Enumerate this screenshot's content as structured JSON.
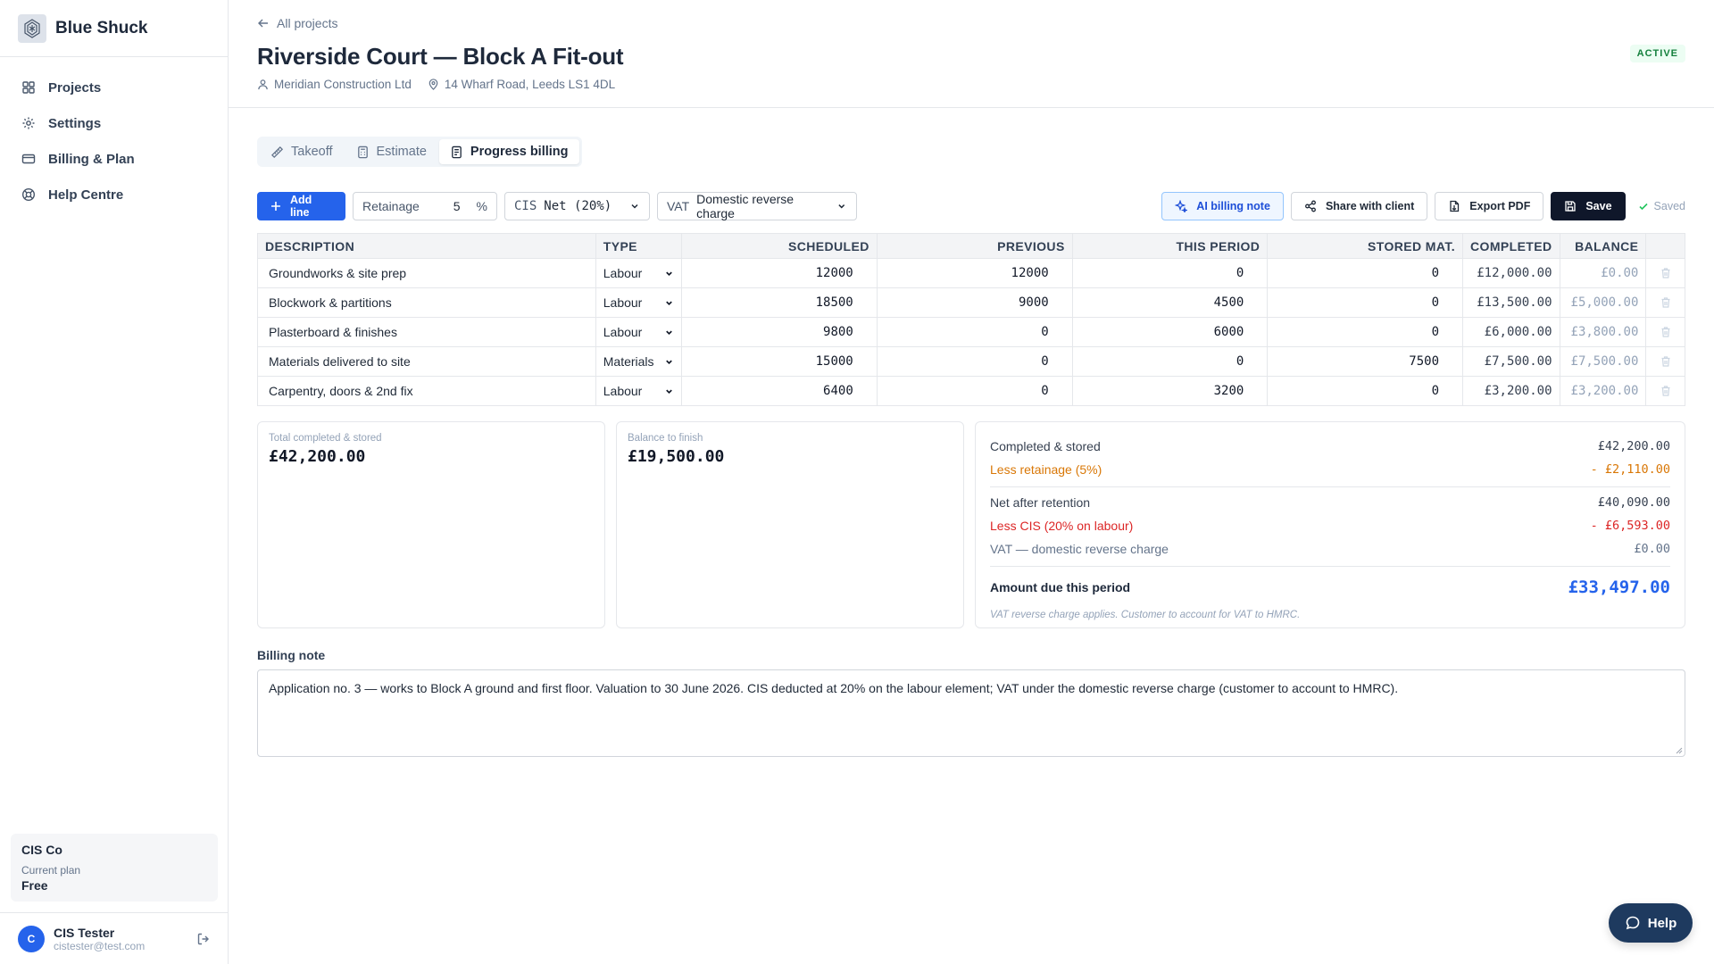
{
  "brand": {
    "name": "Blue Shuck"
  },
  "sidebar": {
    "items": [
      {
        "label": "Projects",
        "icon": "grid-icon"
      },
      {
        "label": "Settings",
        "icon": "gear-icon"
      },
      {
        "label": "Billing & Plan",
        "icon": "card-icon"
      },
      {
        "label": "Help Centre",
        "icon": "lifebuoy-icon"
      }
    ],
    "plan": {
      "company": "CIS Co",
      "label": "Current plan",
      "value": "Free"
    },
    "user": {
      "initial": "C",
      "name": "CIS Tester",
      "email": "cistester@test.com"
    }
  },
  "header": {
    "back_label": "All projects",
    "title": "Riverside Court — Block A Fit-out",
    "client": "Meridian Construction Ltd",
    "address": "14 Wharf Road, Leeds LS1 4DL",
    "status": "ACTIVE"
  },
  "tabs": [
    {
      "label": "Takeoff"
    },
    {
      "label": "Estimate"
    },
    {
      "label": "Progress billing",
      "active": true
    }
  ],
  "toolbar": {
    "add_line": "Add line",
    "retainage_label": "Retainage",
    "retainage_value": "5",
    "retainage_unit": "%",
    "cis_label": "CIS",
    "cis_value": "Net (20%)",
    "vat_label": "VAT",
    "vat_value": "Domestic reverse charge",
    "ai_note": "AI billing note",
    "share": "Share with client",
    "export": "Export PDF",
    "save": "Save",
    "saved": "Saved"
  },
  "table": {
    "columns": [
      "DESCRIPTION",
      "TYPE",
      "SCHEDULED",
      "PREVIOUS",
      "THIS PERIOD",
      "STORED MAT.",
      "COMPLETED",
      "BALANCE"
    ],
    "rows": [
      {
        "description": "Groundworks & site prep",
        "type": "Labour",
        "scheduled": "12000",
        "previous": "12000",
        "this_period": "0",
        "stored": "0",
        "completed": "£12,000.00",
        "balance": "£0.00"
      },
      {
        "description": "Blockwork & partitions",
        "type": "Labour",
        "scheduled": "18500",
        "previous": "9000",
        "this_period": "4500",
        "stored": "0",
        "completed": "£13,500.00",
        "balance": "£5,000.00"
      },
      {
        "description": "Plasterboard & finishes",
        "type": "Labour",
        "scheduled": "9800",
        "previous": "0",
        "this_period": "6000",
        "stored": "0",
        "completed": "£6,000.00",
        "balance": "£3,800.00"
      },
      {
        "description": "Materials delivered to site",
        "type": "Materials",
        "scheduled": "15000",
        "previous": "0",
        "this_period": "0",
        "stored": "7500",
        "completed": "£7,500.00",
        "balance": "£7,500.00"
      },
      {
        "description": "Carpentry, doors & 2nd fix",
        "type": "Labour",
        "scheduled": "6400",
        "previous": "0",
        "this_period": "3200",
        "stored": "0",
        "completed": "£3,200.00",
        "balance": "£3,200.00"
      }
    ]
  },
  "summary": {
    "total_label": "Total completed & stored",
    "total_value": "£42,200.00",
    "balance_label": "Balance to finish",
    "balance_value": "£19,500.00",
    "breakdown": {
      "completed_label": "Completed & stored",
      "completed_value": "£42,200.00",
      "retainage_label": "Less retainage (5%)",
      "retainage_value": "- £2,110.00",
      "net_label": "Net after retention",
      "net_value": "£40,090.00",
      "cis_label": "Less CIS (20% on labour)",
      "cis_value": "- £6,593.00",
      "vat_label": "VAT — domestic reverse charge",
      "vat_value": "£0.00",
      "due_label": "Amount due this period",
      "due_value": "£33,497.00",
      "footnote": "VAT reverse charge applies. Customer to account for VAT to HMRC."
    }
  },
  "billing_note": {
    "label": "Billing note",
    "text": "Application no. 3 — works to Block A ground and first floor. Valuation to 30 June 2026. CIS deducted at 20% on the labour element; VAT under the domestic reverse charge (customer to account to HMRC)."
  },
  "help": {
    "label": "Help"
  },
  "colors": {
    "accent": "#2563eb",
    "dark": "#0f172a",
    "retainage": "#d97706",
    "cis": "#dc2626",
    "status": "#15803d"
  }
}
